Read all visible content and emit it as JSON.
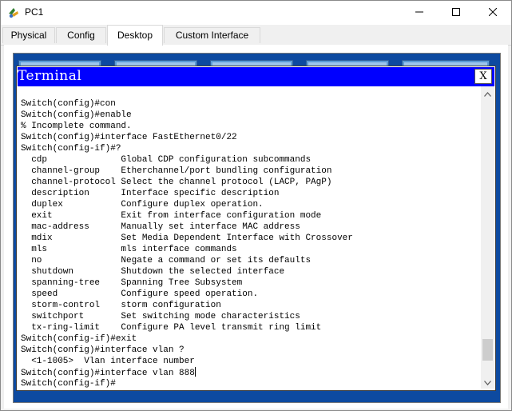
{
  "window": {
    "title": "PC1",
    "controls": {
      "minimize": "minimize-icon",
      "maximize": "maximize-icon",
      "close": "close-icon"
    }
  },
  "tabs": [
    {
      "label": "Physical",
      "active": false
    },
    {
      "label": "Config",
      "active": false
    },
    {
      "label": "Desktop",
      "active": true
    },
    {
      "label": "Custom Interface",
      "active": false
    }
  ],
  "terminal": {
    "title": "Terminal",
    "close_label": "X",
    "lines": [
      "Switch(config)#con",
      "Switch(config)#enable",
      "% Incomplete command.",
      "Switch(config)#interface FastEthernet0/22",
      "Switch(config-if)#?",
      "  cdp              Global CDP configuration subcommands",
      "  channel-group    Etherchannel/port bundling configuration",
      "  channel-protocol Select the channel protocol (LACP, PAgP)",
      "  description      Interface specific description",
      "  duplex           Configure duplex operation.",
      "  exit             Exit from interface configuration mode",
      "  mac-address      Manually set interface MAC address",
      "  mdix             Set Media Dependent Interface with Crossover",
      "  mls              mls interface commands",
      "  no               Negate a command or set its defaults",
      "  shutdown         Shutdown the selected interface",
      "  spanning-tree    Spanning Tree Subsystem",
      "  speed            Configure speed operation.",
      "  storm-control    storm configuration",
      "  switchport       Set switching mode characteristics",
      "  tx-ring-limit    Configure PA level transmit ring limit",
      "Switch(config-if)#exit",
      "Switch(config)#interface vlan ?",
      "  <1-1005>  Vlan interface number",
      "Switch(config)#interface vlan 888",
      "Switch(config-if)#"
    ],
    "cursor_line_index": 24,
    "scroll_position": 0.92
  },
  "colors": {
    "terminal_header": "#0000ff",
    "desktop_background": "#0d4aa0"
  }
}
